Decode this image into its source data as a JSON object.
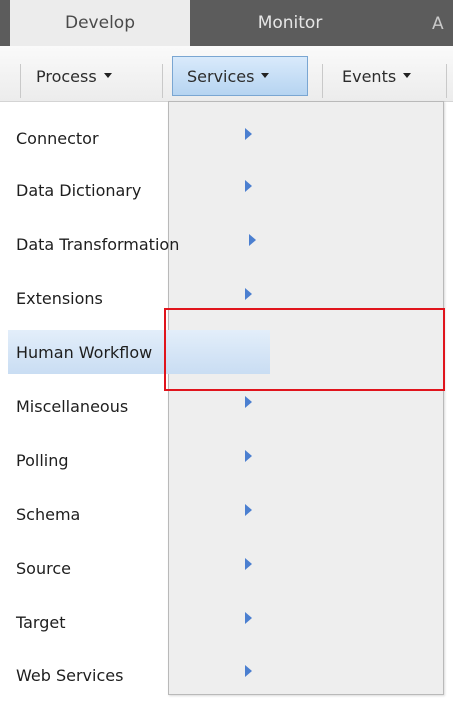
{
  "tabs": [
    {
      "label": "Develop",
      "active": true
    },
    {
      "label": "Monitor",
      "active": false
    },
    {
      "label": "A",
      "active": false
    }
  ],
  "menubar": {
    "items": [
      {
        "label": "Process"
      },
      {
        "label": "Services",
        "open": true
      },
      {
        "label": "Events"
      }
    ]
  },
  "dropdown": {
    "items": [
      {
        "label": "Connector",
        "has_submenu": true
      },
      {
        "label": "Data Dictionary",
        "has_submenu": true
      },
      {
        "label": "Data Transformation",
        "has_submenu": true
      },
      {
        "label": "Extensions",
        "has_submenu": true
      },
      {
        "label": "Human Workflow",
        "has_submenu": false,
        "highlighted": true
      },
      {
        "label": "Miscellaneous",
        "has_submenu": true
      },
      {
        "label": "Polling",
        "has_submenu": true
      },
      {
        "label": "Schema",
        "has_submenu": true
      },
      {
        "label": "Source",
        "has_submenu": true
      },
      {
        "label": "Target",
        "has_submenu": true
      },
      {
        "label": "Web Services",
        "has_submenu": true
      }
    ]
  },
  "colors": {
    "tabstrip": "#5c5c5c",
    "highlight_outline": "#e0141c",
    "submenu_arrow": "#4b7fd0",
    "menu_hover": "#c9ddf3"
  }
}
